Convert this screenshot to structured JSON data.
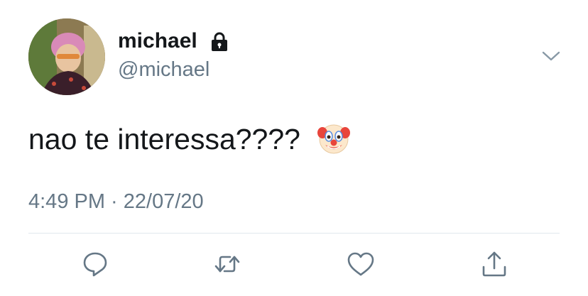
{
  "user": {
    "display_name": "michael",
    "handle": "@michael",
    "protected_icon": "lock-icon",
    "avatar_icon": "profile-photo"
  },
  "tweet": {
    "text": "nao te interessa????",
    "emoji": "clown-face-emoji",
    "timestamp": "4:49 PM · 22/07/20"
  },
  "actions": {
    "reply_icon": "reply-icon",
    "retweet_icon": "retweet-icon",
    "like_icon": "heart-icon",
    "share_icon": "share-icon",
    "more_icon": "chevron-down-icon"
  },
  "colors": {
    "text_primary": "#14171a",
    "text_secondary": "#657786",
    "divider": "#e1e8ed"
  }
}
